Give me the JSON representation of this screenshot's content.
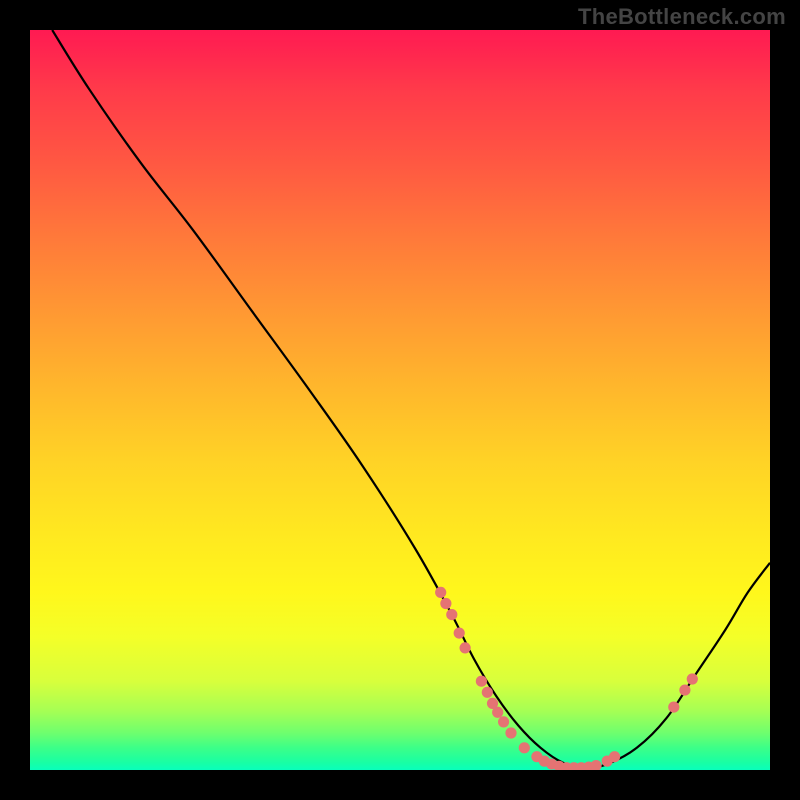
{
  "watermark": "TheBottleneck.com",
  "chart_data": {
    "type": "line",
    "title": "",
    "xlabel": "",
    "ylabel": "",
    "xlim": [
      0,
      100
    ],
    "ylim": [
      0,
      100
    ],
    "curve": {
      "x": [
        3,
        8,
        15,
        22,
        30,
        38,
        45,
        52,
        57,
        60,
        63,
        66,
        69,
        72,
        75,
        78,
        82,
        86,
        90,
        94,
        97,
        100
      ],
      "y": [
        100,
        92,
        82,
        73,
        62,
        51,
        41,
        30,
        21,
        15,
        10,
        6,
        3,
        1,
        0.3,
        0.8,
        3,
        7,
        13,
        19,
        24,
        28
      ]
    },
    "points": [
      {
        "x": 55.5,
        "y": 24
      },
      {
        "x": 56.2,
        "y": 22.5
      },
      {
        "x": 57.0,
        "y": 21
      },
      {
        "x": 58.0,
        "y": 18.5
      },
      {
        "x": 58.8,
        "y": 16.5
      },
      {
        "x": 61.0,
        "y": 12
      },
      {
        "x": 61.8,
        "y": 10.5
      },
      {
        "x": 62.5,
        "y": 9
      },
      {
        "x": 63.2,
        "y": 7.8
      },
      {
        "x": 64.0,
        "y": 6.5
      },
      {
        "x": 65.0,
        "y": 5
      },
      {
        "x": 66.8,
        "y": 3
      },
      {
        "x": 68.5,
        "y": 1.8
      },
      {
        "x": 69.5,
        "y": 1.2
      },
      {
        "x": 70.5,
        "y": 0.8
      },
      {
        "x": 71.5,
        "y": 0.5
      },
      {
        "x": 72.5,
        "y": 0.3
      },
      {
        "x": 73.5,
        "y": 0.3
      },
      {
        "x": 74.5,
        "y": 0.3
      },
      {
        "x": 75.5,
        "y": 0.4
      },
      {
        "x": 76.5,
        "y": 0.6
      },
      {
        "x": 78.0,
        "y": 1.2
      },
      {
        "x": 79.0,
        "y": 1.8
      },
      {
        "x": 87.0,
        "y": 8.5
      },
      {
        "x": 88.5,
        "y": 10.8
      },
      {
        "x": 89.5,
        "y": 12.3
      }
    ]
  }
}
